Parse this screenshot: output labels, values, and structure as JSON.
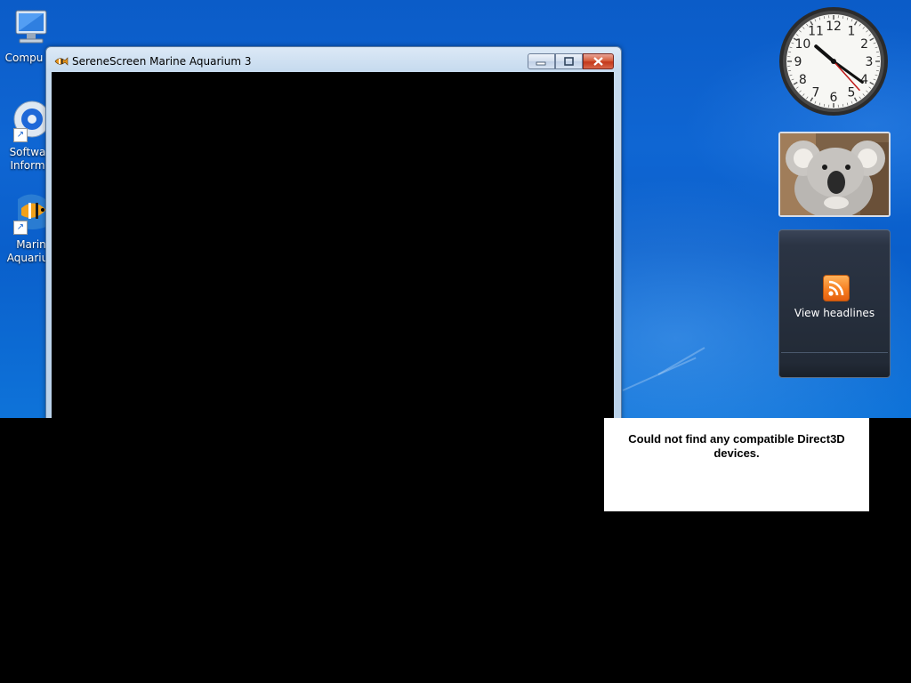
{
  "window": {
    "title": "SereneScreen Marine Aquarium 3"
  },
  "desktop_icons": [
    {
      "label": "Compu",
      "icon": "computer-icon"
    },
    {
      "label_line1": "Softwa",
      "label_line2": "Inform",
      "icon": "software-info-icon"
    },
    {
      "label_line1": "Marin",
      "label_line2": "Aquariu",
      "icon": "marine-aquarium-icon"
    }
  ],
  "gadgets": {
    "clock": {
      "hour": 10,
      "minute": 21,
      "second": 23,
      "numerals": [
        "12",
        "1",
        "2",
        "3",
        "4",
        "5",
        "6",
        "7",
        "8",
        "9",
        "10",
        "11"
      ]
    },
    "photo": {
      "subject": "koala-photo"
    },
    "feed": {
      "label": "View headlines",
      "icon": "rss-icon"
    }
  },
  "error": {
    "message": "Could not find any compatible Direct3D devices."
  },
  "colors": {
    "desktop_blue": "#0b5cc8",
    "close_red": "#c4381a",
    "rss_orange": "#f57b1e"
  }
}
